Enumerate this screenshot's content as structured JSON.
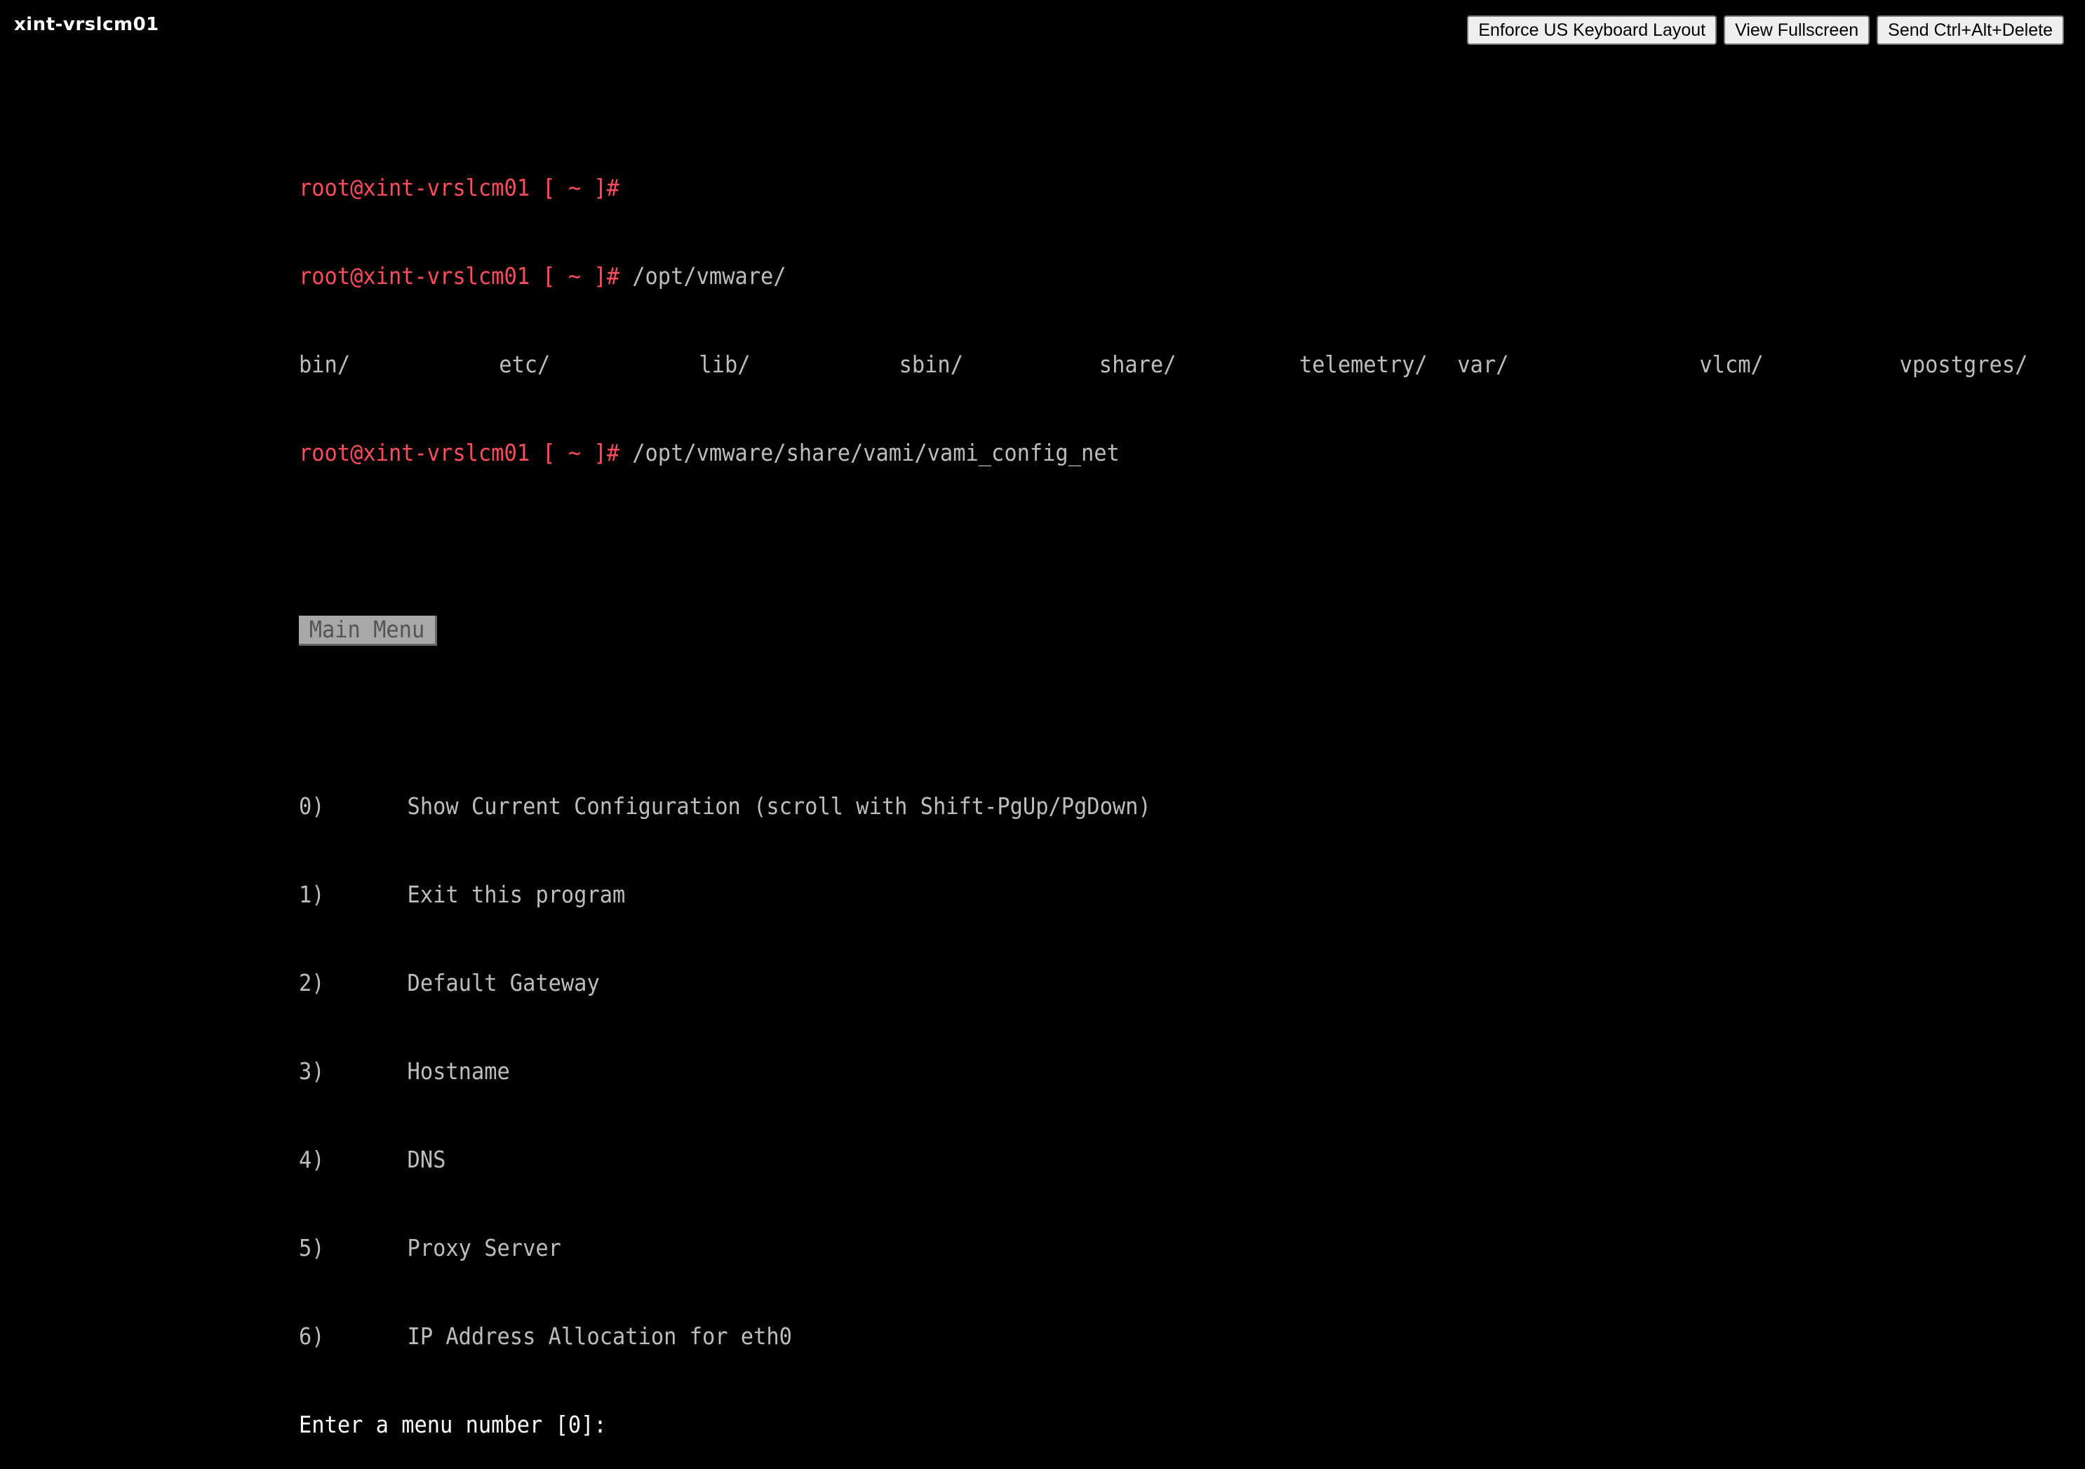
{
  "window": {
    "title": "xint-vrslcm01"
  },
  "toolbar": {
    "enforce_label": "Enforce US Keyboard Layout",
    "fullscreen_label": "View Fullscreen",
    "cad_label": "Send Ctrl+Alt+Delete"
  },
  "colors": {
    "prompt": "#ff4d5e",
    "text": "#bdbdbd",
    "menu_title_bg": "#a8a8a8"
  },
  "terminal": {
    "prompt": "root@xint-vrslcm01 [ ~ ]#",
    "lines": [
      {
        "prompt": "root@xint-vrslcm01 [ ~ ]#",
        "cmd": ""
      },
      {
        "prompt": "root@xint-vrslcm01 [ ~ ]#",
        "cmd": " /opt/vmware/"
      },
      {
        "prompt": "root@xint-vrslcm01 [ ~ ]#",
        "cmd": " /opt/vmware/share/vami/vami_config_net"
      }
    ],
    "dirs": [
      "bin/",
      "etc/",
      "lib/",
      "sbin/",
      "share/",
      "telemetry/",
      "var/",
      "vlcm/",
      "vpostgres/"
    ],
    "menu_title": "Main Menu",
    "menu": [
      {
        "num": "0)",
        "label": "Show Current Configuration (scroll with Shift-PgUp/PgDown)"
      },
      {
        "num": "1)",
        "label": "Exit this program"
      },
      {
        "num": "2)",
        "label": "Default Gateway"
      },
      {
        "num": "3)",
        "label": "Hostname"
      },
      {
        "num": "4)",
        "label": "DNS"
      },
      {
        "num": "5)",
        "label": "Proxy Server"
      },
      {
        "num": "6)",
        "label": "IP Address Allocation for eth0"
      }
    ],
    "input_prompt": "Enter a menu number [0]:"
  }
}
